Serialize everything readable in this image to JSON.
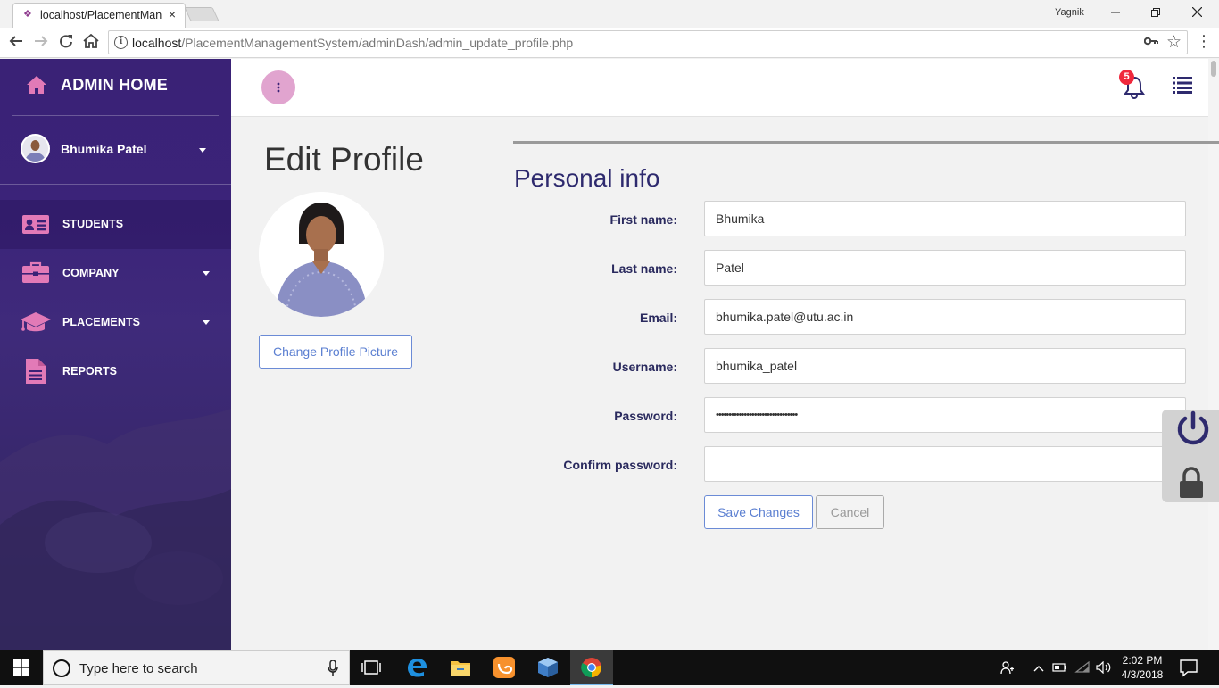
{
  "browser": {
    "tab_title": "localhost/PlacementMan",
    "tab_close": "×",
    "user_label": "Yagnik",
    "url_host": "localhost",
    "url_path": "/PlacementManagementSystem/adminDash/admin_update_profile.php",
    "icons": {
      "back": "back-arrow-icon",
      "forward": "forward-arrow-icon",
      "reload": "reload-icon",
      "home": "home-icon",
      "info": "info-icon",
      "key": "key-icon",
      "star": "star-icon",
      "menu": "kebab-menu-icon"
    }
  },
  "sidebar": {
    "brand": "ADMIN HOME",
    "user_name": "Bhumika Patel",
    "items": [
      {
        "label": "STUDENTS",
        "icon": "id-card-icon",
        "has_caret": false
      },
      {
        "label": "COMPANY",
        "icon": "briefcase-icon",
        "has_caret": true
      },
      {
        "label": "PLACEMENTS",
        "icon": "graduation-cap-icon",
        "has_caret": true
      },
      {
        "label": "REPORTS",
        "icon": "document-icon",
        "has_caret": false
      }
    ]
  },
  "topbar": {
    "notification_count": "5"
  },
  "profile": {
    "title": "Edit Profile",
    "change_picture_label": "Change Profile Picture"
  },
  "form": {
    "section_title": "Personal info",
    "fields": [
      {
        "label": "First name:",
        "value": "Bhumika",
        "type": "text"
      },
      {
        "label": "Last name:",
        "value": "Patel",
        "type": "text"
      },
      {
        "label": "Email:",
        "value": "bhumika.patel@utu.ac.in",
        "type": "text"
      },
      {
        "label": "Username:",
        "value": "bhumika_patel",
        "type": "text"
      },
      {
        "label": "Password:",
        "value": "••••••••••••••••••••••••••••••••",
        "type": "text"
      },
      {
        "label": "Confirm password:",
        "value": "",
        "type": "text"
      }
    ],
    "save_label": "Save Changes",
    "cancel_label": "Cancel"
  },
  "taskbar": {
    "search_placeholder": "Type here to search",
    "time": "2:02 PM",
    "date": "4/3/2018"
  },
  "colors": {
    "sidebar_top": "#3a2276",
    "accent_pink": "#c0569b",
    "kebab_bg": "#e1a4cf",
    "heading_navy": "#2e2a6e",
    "badge_red": "#f0283c",
    "button_blue": "#5b7fd1"
  }
}
